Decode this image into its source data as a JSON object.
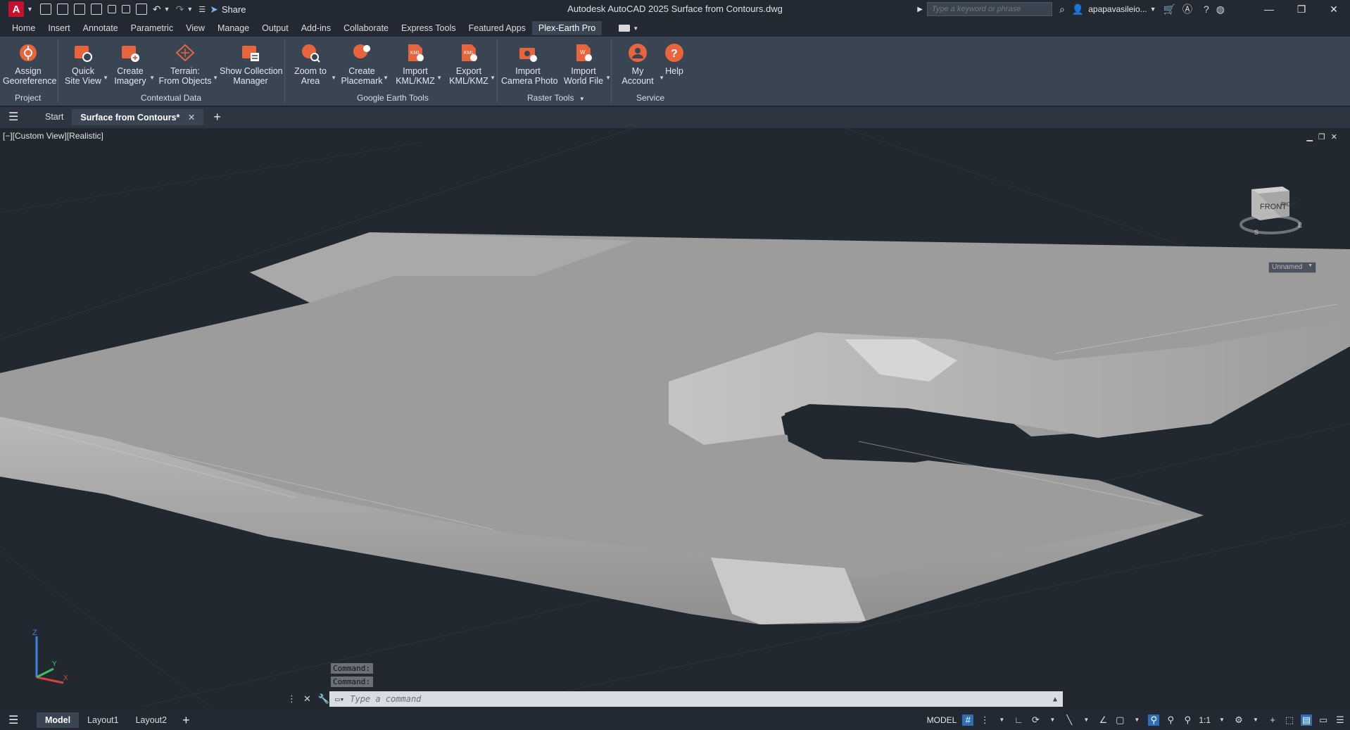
{
  "app": {
    "title": "Autodesk AutoCAD 2025   Surface from Contours.dwg",
    "logo_letter": "A"
  },
  "quick_access": {
    "share_label": "Share"
  },
  "search": {
    "placeholder": "Type a keyword or phrase"
  },
  "user": {
    "name": "apapavasileio..."
  },
  "menu_tabs": [
    {
      "label": "Home"
    },
    {
      "label": "Insert"
    },
    {
      "label": "Annotate"
    },
    {
      "label": "Parametric"
    },
    {
      "label": "View"
    },
    {
      "label": "Manage"
    },
    {
      "label": "Output"
    },
    {
      "label": "Add-ins"
    },
    {
      "label": "Collaborate"
    },
    {
      "label": "Express Tools"
    },
    {
      "label": "Featured Apps"
    },
    {
      "label": "Plex-Earth Pro",
      "active": true
    }
  ],
  "ribbon": {
    "buttons": [
      {
        "line1": "Assign",
        "line2": "Georeference"
      },
      {
        "line1": "Quick",
        "line2": "Site View"
      },
      {
        "line1": "Create",
        "line2": "Imagery"
      },
      {
        "line1": "Terrain:",
        "line2": "From Objects"
      },
      {
        "line1": "Show Collection",
        "line2": "Manager"
      },
      {
        "line1": "Zoom to",
        "line2": "Area"
      },
      {
        "line1": "Create",
        "line2": "Placemark"
      },
      {
        "line1": "Import",
        "line2": "KML/KMZ"
      },
      {
        "line1": "Export",
        "line2": "KML/KMZ"
      },
      {
        "line1": "Import",
        "line2": "Camera Photo"
      },
      {
        "line1": "Import",
        "line2": "World File"
      },
      {
        "line1": "My",
        "line2": "Account"
      },
      {
        "line1": "Help",
        "line2": ""
      }
    ],
    "panels": {
      "project": "Project",
      "contextual": "Contextual Data",
      "google": "Google Earth Tools",
      "raster": "Raster Tools",
      "service": "Service"
    },
    "accent_color": "#e8643c"
  },
  "doc_tabs": {
    "start": "Start",
    "active": "Surface from Contours*"
  },
  "viewport": {
    "view_label": "[−][Custom View][Realistic]",
    "viewcube_front": "FRONT",
    "viewcube_right": "RIGHT",
    "viewcube_s": "S",
    "viewcube_e": "E",
    "named_view": "Unnamed",
    "ucs_z": "Z",
    "ucs_y": "Y",
    "ucs_x": "X"
  },
  "command": {
    "history": [
      "Command:",
      "Command:"
    ],
    "placeholder": "Type a command"
  },
  "status": {
    "layout_tabs": [
      {
        "label": "Model",
        "active": true
      },
      {
        "label": "Layout1"
      },
      {
        "label": "Layout2"
      }
    ],
    "model_label": "MODEL",
    "scale": "1:1"
  }
}
